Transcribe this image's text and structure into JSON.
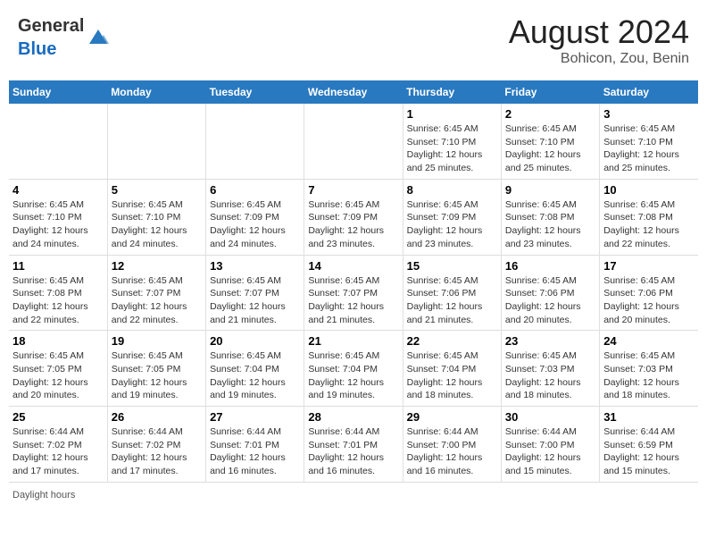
{
  "header": {
    "logo_general": "General",
    "logo_blue": "Blue",
    "title": "August 2024",
    "subtitle": "Bohicon, Zou, Benin"
  },
  "days_of_week": [
    "Sunday",
    "Monday",
    "Tuesday",
    "Wednesday",
    "Thursday",
    "Friday",
    "Saturday"
  ],
  "weeks": [
    [
      {
        "day": "",
        "info": ""
      },
      {
        "day": "",
        "info": ""
      },
      {
        "day": "",
        "info": ""
      },
      {
        "day": "",
        "info": ""
      },
      {
        "day": "1",
        "info": "Sunrise: 6:45 AM\nSunset: 7:10 PM\nDaylight: 12 hours\nand 25 minutes."
      },
      {
        "day": "2",
        "info": "Sunrise: 6:45 AM\nSunset: 7:10 PM\nDaylight: 12 hours\nand 25 minutes."
      },
      {
        "day": "3",
        "info": "Sunrise: 6:45 AM\nSunset: 7:10 PM\nDaylight: 12 hours\nand 25 minutes."
      }
    ],
    [
      {
        "day": "4",
        "info": "Sunrise: 6:45 AM\nSunset: 7:10 PM\nDaylight: 12 hours\nand 24 minutes."
      },
      {
        "day": "5",
        "info": "Sunrise: 6:45 AM\nSunset: 7:10 PM\nDaylight: 12 hours\nand 24 minutes."
      },
      {
        "day": "6",
        "info": "Sunrise: 6:45 AM\nSunset: 7:09 PM\nDaylight: 12 hours\nand 24 minutes."
      },
      {
        "day": "7",
        "info": "Sunrise: 6:45 AM\nSunset: 7:09 PM\nDaylight: 12 hours\nand 23 minutes."
      },
      {
        "day": "8",
        "info": "Sunrise: 6:45 AM\nSunset: 7:09 PM\nDaylight: 12 hours\nand 23 minutes."
      },
      {
        "day": "9",
        "info": "Sunrise: 6:45 AM\nSunset: 7:08 PM\nDaylight: 12 hours\nand 23 minutes."
      },
      {
        "day": "10",
        "info": "Sunrise: 6:45 AM\nSunset: 7:08 PM\nDaylight: 12 hours\nand 22 minutes."
      }
    ],
    [
      {
        "day": "11",
        "info": "Sunrise: 6:45 AM\nSunset: 7:08 PM\nDaylight: 12 hours\nand 22 minutes."
      },
      {
        "day": "12",
        "info": "Sunrise: 6:45 AM\nSunset: 7:07 PM\nDaylight: 12 hours\nand 22 minutes."
      },
      {
        "day": "13",
        "info": "Sunrise: 6:45 AM\nSunset: 7:07 PM\nDaylight: 12 hours\nand 21 minutes."
      },
      {
        "day": "14",
        "info": "Sunrise: 6:45 AM\nSunset: 7:07 PM\nDaylight: 12 hours\nand 21 minutes."
      },
      {
        "day": "15",
        "info": "Sunrise: 6:45 AM\nSunset: 7:06 PM\nDaylight: 12 hours\nand 21 minutes."
      },
      {
        "day": "16",
        "info": "Sunrise: 6:45 AM\nSunset: 7:06 PM\nDaylight: 12 hours\nand 20 minutes."
      },
      {
        "day": "17",
        "info": "Sunrise: 6:45 AM\nSunset: 7:06 PM\nDaylight: 12 hours\nand 20 minutes."
      }
    ],
    [
      {
        "day": "18",
        "info": "Sunrise: 6:45 AM\nSunset: 7:05 PM\nDaylight: 12 hours\nand 20 minutes."
      },
      {
        "day": "19",
        "info": "Sunrise: 6:45 AM\nSunset: 7:05 PM\nDaylight: 12 hours\nand 19 minutes."
      },
      {
        "day": "20",
        "info": "Sunrise: 6:45 AM\nSunset: 7:04 PM\nDaylight: 12 hours\nand 19 minutes."
      },
      {
        "day": "21",
        "info": "Sunrise: 6:45 AM\nSunset: 7:04 PM\nDaylight: 12 hours\nand 19 minutes."
      },
      {
        "day": "22",
        "info": "Sunrise: 6:45 AM\nSunset: 7:04 PM\nDaylight: 12 hours\nand 18 minutes."
      },
      {
        "day": "23",
        "info": "Sunrise: 6:45 AM\nSunset: 7:03 PM\nDaylight: 12 hours\nand 18 minutes."
      },
      {
        "day": "24",
        "info": "Sunrise: 6:45 AM\nSunset: 7:03 PM\nDaylight: 12 hours\nand 18 minutes."
      }
    ],
    [
      {
        "day": "25",
        "info": "Sunrise: 6:44 AM\nSunset: 7:02 PM\nDaylight: 12 hours\nand 17 minutes."
      },
      {
        "day": "26",
        "info": "Sunrise: 6:44 AM\nSunset: 7:02 PM\nDaylight: 12 hours\nand 17 minutes."
      },
      {
        "day": "27",
        "info": "Sunrise: 6:44 AM\nSunset: 7:01 PM\nDaylight: 12 hours\nand 16 minutes."
      },
      {
        "day": "28",
        "info": "Sunrise: 6:44 AM\nSunset: 7:01 PM\nDaylight: 12 hours\nand 16 minutes."
      },
      {
        "day": "29",
        "info": "Sunrise: 6:44 AM\nSunset: 7:00 PM\nDaylight: 12 hours\nand 16 minutes."
      },
      {
        "day": "30",
        "info": "Sunrise: 6:44 AM\nSunset: 7:00 PM\nDaylight: 12 hours\nand 15 minutes."
      },
      {
        "day": "31",
        "info": "Sunrise: 6:44 AM\nSunset: 6:59 PM\nDaylight: 12 hours\nand 15 minutes."
      }
    ]
  ],
  "footer": "Daylight hours"
}
